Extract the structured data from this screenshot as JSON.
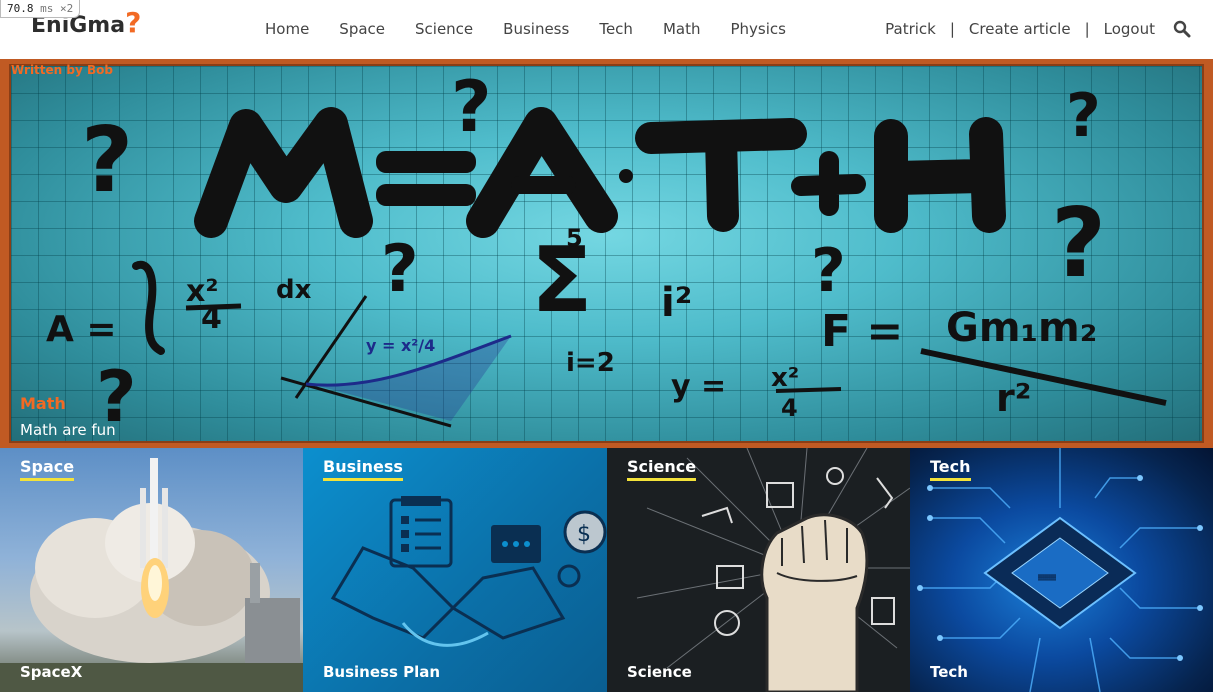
{
  "timing": {
    "value": "70.8",
    "unit": "ms ×2"
  },
  "brand": {
    "name": "EniGma",
    "mark": "?"
  },
  "nav": {
    "items": [
      "Home",
      "Space",
      "Science",
      "Business",
      "Tech",
      "Math",
      "Physics"
    ]
  },
  "user_nav": {
    "username": "Patrick",
    "create": "Create article",
    "logout": "Logout",
    "separator": "|",
    "search_icon": "search-icon"
  },
  "hero": {
    "author": "Written by Bob",
    "category": "Math",
    "title": "Math are fun"
  },
  "cards": [
    {
      "category": "Space",
      "title": "SpaceX"
    },
    {
      "category": "Business",
      "title": "Business Plan"
    },
    {
      "category": "Science",
      "title": "Science"
    },
    {
      "category": "Tech",
      "title": "Tech"
    }
  ],
  "colors": {
    "accent": "#f26a24",
    "tag_underline": "#f3e23a",
    "board": "#4fbccb",
    "frame": "#c05a23"
  }
}
